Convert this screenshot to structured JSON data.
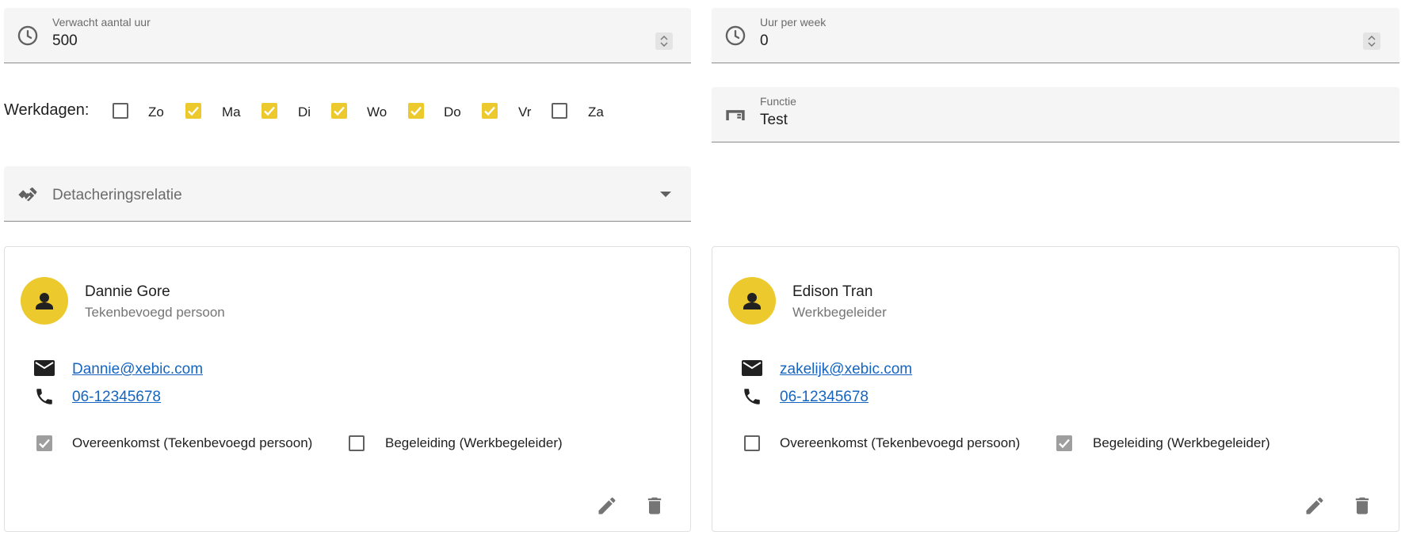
{
  "fields": {
    "verwacht_aantal_uur": {
      "label": "Verwacht aantal uur",
      "value": "500",
      "icon": "clock-icon"
    },
    "uur_per_week": {
      "label": "Uur per week",
      "value": "0",
      "icon": "clock-icon"
    },
    "functie": {
      "label": "Functie",
      "value": "Test",
      "icon": "desk-icon"
    },
    "detacheringsrelatie": {
      "placeholder": "Detacheringsrelatie",
      "icon": "handshake-icon"
    }
  },
  "werkdagen": {
    "label": "Werkdagen:",
    "days": [
      {
        "label": "Zo",
        "checked": false
      },
      {
        "label": "Ma",
        "checked": true
      },
      {
        "label": "Di",
        "checked": true
      },
      {
        "label": "Wo",
        "checked": true
      },
      {
        "label": "Do",
        "checked": true
      },
      {
        "label": "Vr",
        "checked": true
      },
      {
        "label": "Za",
        "checked": false
      }
    ]
  },
  "contacts": [
    {
      "name": "Dannie Gore",
      "role": "Tekenbevoegd persoon",
      "email": "Dannie@xebic.com",
      "phone": "06-12345678",
      "overeenkomst_label": "Overeenkomst (Tekenbevoegd persoon)",
      "overeenkomst_checked": true,
      "begeleiding_label": "Begeleiding (Werkbegeleider)",
      "begeleiding_checked": false
    },
    {
      "name": "Edison Tran",
      "role": "Werkbegeleider",
      "email": "zakelijk@xebic.com",
      "phone": "06-12345678",
      "overeenkomst_label": "Overeenkomst (Tekenbevoegd persoon)",
      "overeenkomst_checked": false,
      "begeleiding_label": "Begeleiding (Werkbegeleider)",
      "begeleiding_checked": true
    }
  ],
  "colors": {
    "accent": "#ecc92c",
    "link": "#1565c0",
    "field_bg": "#f5f5f5"
  }
}
